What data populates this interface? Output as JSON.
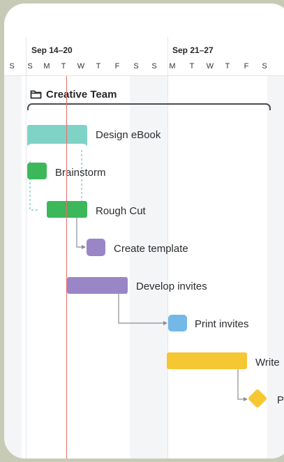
{
  "timeline": {
    "weeks": [
      {
        "label": "Sep 14–20"
      },
      {
        "label": "Sep 21–27"
      }
    ],
    "days": [
      "S",
      "S",
      "M",
      "T",
      "W",
      "T",
      "F",
      "S",
      "S",
      "M",
      "T",
      "W",
      "T",
      "F",
      "S"
    ]
  },
  "group": {
    "title": "Creative Team",
    "icon": "folder-icon"
  },
  "tasks": [
    {
      "label": "Design eBook",
      "color": "#7fd3c6",
      "type": "summary"
    },
    {
      "label": "Brainstorm",
      "color": "#3cb85a",
      "type": "task"
    },
    {
      "label": "Rough Cut",
      "color": "#3cb85a",
      "type": "task"
    },
    {
      "label": "Create template",
      "color": "#9a86c6",
      "type": "task"
    },
    {
      "label": "Develop invites",
      "color": "#9a86c6",
      "type": "task"
    },
    {
      "label": "Print invites",
      "color": "#74b8e8",
      "type": "task"
    },
    {
      "label": "Write",
      "color": "#f5c733",
      "type": "task"
    },
    {
      "label": "P",
      "color": "#f5c733",
      "type": "milestone"
    }
  ],
  "colors": {
    "today_line": "#ec6b6b",
    "dependency_line": "#8a8d93",
    "brainstorm_dependency": "#4fb3a3"
  }
}
